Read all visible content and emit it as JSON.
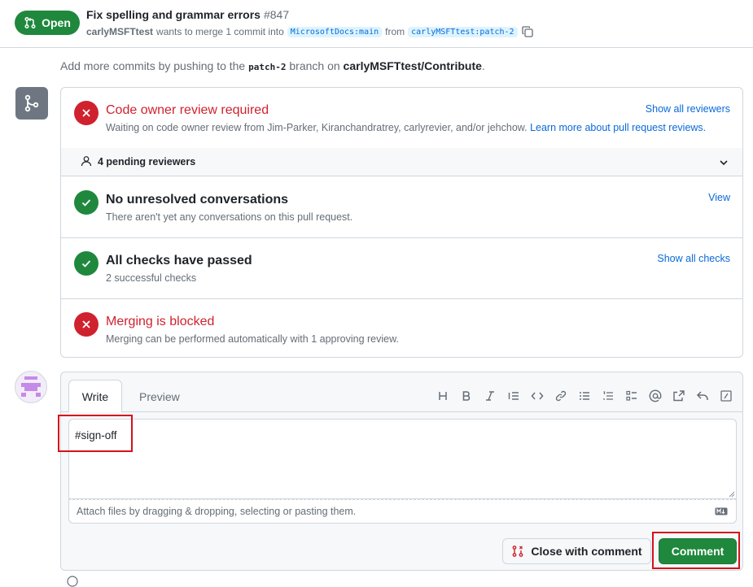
{
  "pr": {
    "state": "Open",
    "title": "Fix spelling and grammar errors",
    "number": "#847",
    "author": "carlyMSFTtest",
    "merge_text": "wants to merge 1 commit into",
    "base_branch": "MicrosoftDocs:main",
    "from_text": "from",
    "head_branch": "carlyMSFTtest:patch-2"
  },
  "push_hint": {
    "prefix": "Add more commits by pushing to the",
    "branch": "patch-2",
    "middle": "branch on",
    "repo": "carlyMSFTtest/Contribute",
    "suffix": "."
  },
  "merge_box": {
    "code_owner": {
      "title": "Code owner review required",
      "subtitle": "Waiting on code owner review from Jim-Parker, Kiranchandratrey, carlyrevier, and/or jehchow.",
      "link": "Learn more about pull request reviews.",
      "action": "Show all reviewers"
    },
    "pending": {
      "label": "4 pending reviewers"
    },
    "conversations": {
      "title": "No unresolved conversations",
      "subtitle": "There aren't yet any conversations on this pull request.",
      "action": "View"
    },
    "checks": {
      "title": "All checks have passed",
      "subtitle": "2 successful checks",
      "action": "Show all checks"
    },
    "blocked": {
      "title": "Merging is blocked",
      "subtitle": "Merging can be performed automatically with 1 approving review."
    }
  },
  "comment": {
    "tab_write": "Write",
    "tab_preview": "Preview",
    "toolbar": [
      "heading-icon",
      "bold-icon",
      "italic-icon",
      "quote-icon",
      "code-icon",
      "link-icon",
      "unordered-list-icon",
      "ordered-list-icon",
      "task-list-icon",
      "mention-icon",
      "cross-reference-icon",
      "reply-icon",
      "slash-command-icon"
    ],
    "text": "#sign-off",
    "attach_hint": "Attach files by dragging & dropping, selecting or pasting them.",
    "close_button": "Close with comment",
    "comment_button": "Comment"
  },
  "colors": {
    "open_green": "#1f883d",
    "danger_red": "#cf222e",
    "link_blue": "#0969da",
    "highlight_red": "#d4121c"
  }
}
